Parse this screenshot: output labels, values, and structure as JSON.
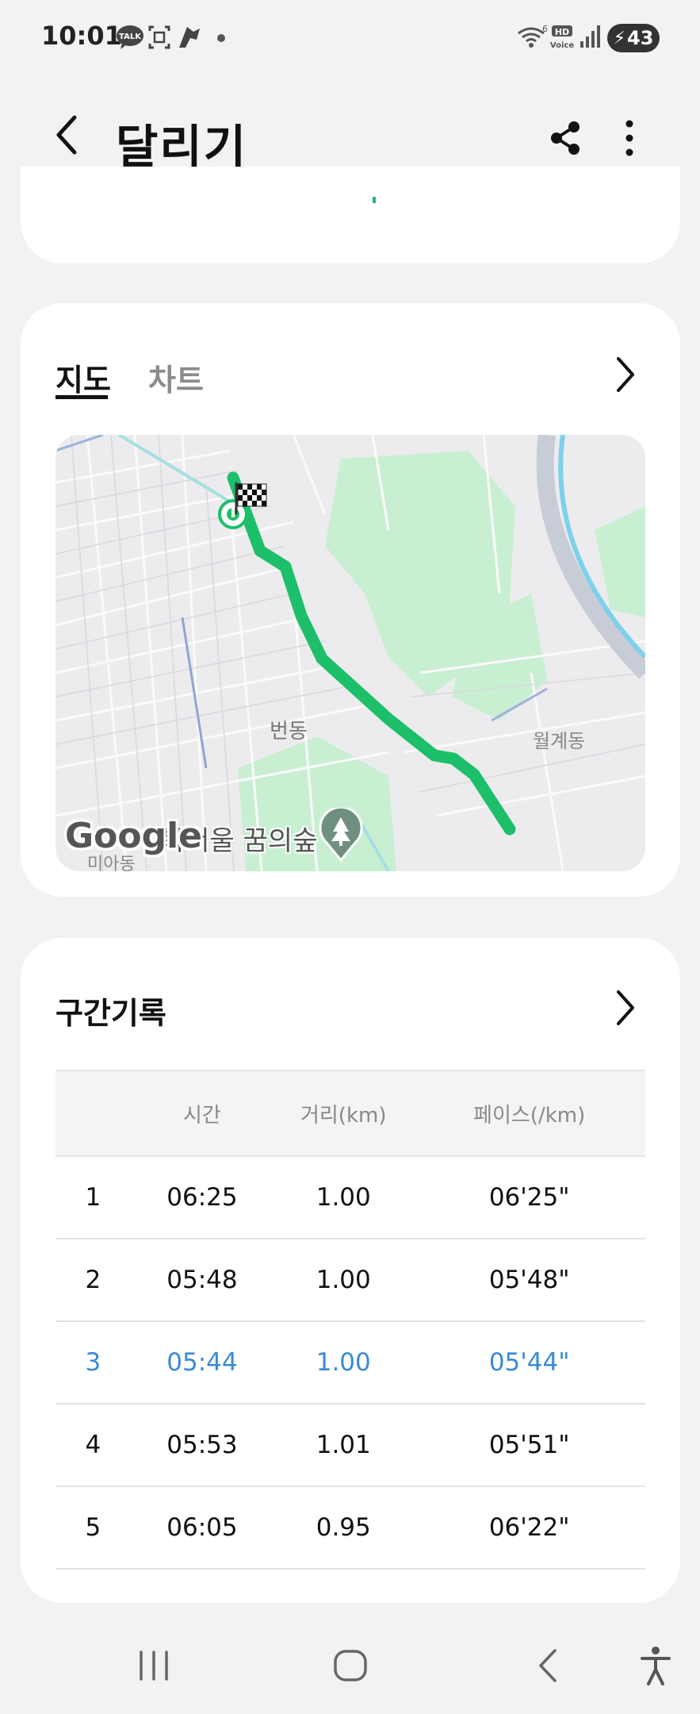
{
  "status_bar": {
    "time": "10:01",
    "icons": [
      "kakaotalk-icon",
      "screenshot-icon",
      "app-icon",
      "dot-icon"
    ],
    "right_icons": [
      "wifi-icon",
      "hd-voice-icon",
      "signal-icon"
    ],
    "battery": "43",
    "hd_label": "HD",
    "voice_label": "Voice",
    "wifi_label": "6"
  },
  "header": {
    "title": "달리기",
    "back_icon": "chevron-left-icon",
    "share_icon": "share-icon",
    "more_icon": "more-vertical-icon"
  },
  "map_card": {
    "tabs": [
      {
        "label": "지도",
        "selected": true
      },
      {
        "label": "차트",
        "selected": false
      }
    ],
    "map_labels": {
      "neighborhood1": "번동",
      "neighborhood2": "월계동",
      "neighborhood3": "미아동",
      "park": "북서울 꿈의숲",
      "provider": "Google"
    },
    "route_color": "#1dbf6a"
  },
  "laps_card": {
    "title": "구간기록",
    "headers": [
      "",
      "시간",
      "거리(km)",
      "페이스(/km)"
    ],
    "rows": [
      {
        "lap": "1",
        "time": "06:25",
        "distance": "1.00",
        "pace": "06'25\"",
        "highlight": false
      },
      {
        "lap": "2",
        "time": "05:48",
        "distance": "1.00",
        "pace": "05'48\"",
        "highlight": false
      },
      {
        "lap": "3",
        "time": "05:44",
        "distance": "1.00",
        "pace": "05'44\"",
        "highlight": true
      },
      {
        "lap": "4",
        "time": "05:53",
        "distance": "1.01",
        "pace": "05'51\"",
        "highlight": false
      },
      {
        "lap": "5",
        "time": "06:05",
        "distance": "0.95",
        "pace": "06'22\"",
        "highlight": false
      }
    ],
    "highlight_color": "#3a8bd6"
  },
  "nav_bar": {
    "buttons": [
      "recents-icon",
      "home-icon",
      "back-icon",
      "accessibility-icon"
    ]
  }
}
